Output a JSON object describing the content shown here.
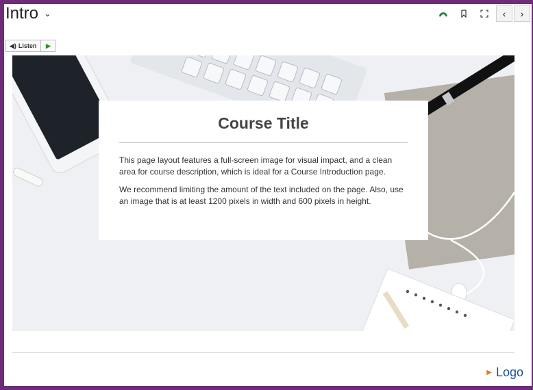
{
  "header": {
    "title": "Intro",
    "title_menu_icon": "chevron-down-icon",
    "tools": [
      "contrast-icon",
      "bookmark-icon",
      "fullscreen-icon"
    ],
    "nav": {
      "prev": "‹",
      "next": "›"
    }
  },
  "audio": {
    "listen_label": "Listen"
  },
  "hero": {
    "card_title": "Course Title",
    "paragraphs": [
      "This page layout features a full-screen image for visual impact, and a clean area for course description, which is ideal for a Course Introduction page.",
      "We recommend limiting the amount of the text included on the page. Also, use an image that is at least 1200 pixels in width and 600 pixels in height."
    ]
  },
  "footer": {
    "logo_text": "Logo"
  },
  "colors": {
    "frame": "#6e2c7a",
    "logo_text": "#1a4e9c",
    "logo_arrow": "#e07a1f",
    "play": "#2f8f2f"
  }
}
